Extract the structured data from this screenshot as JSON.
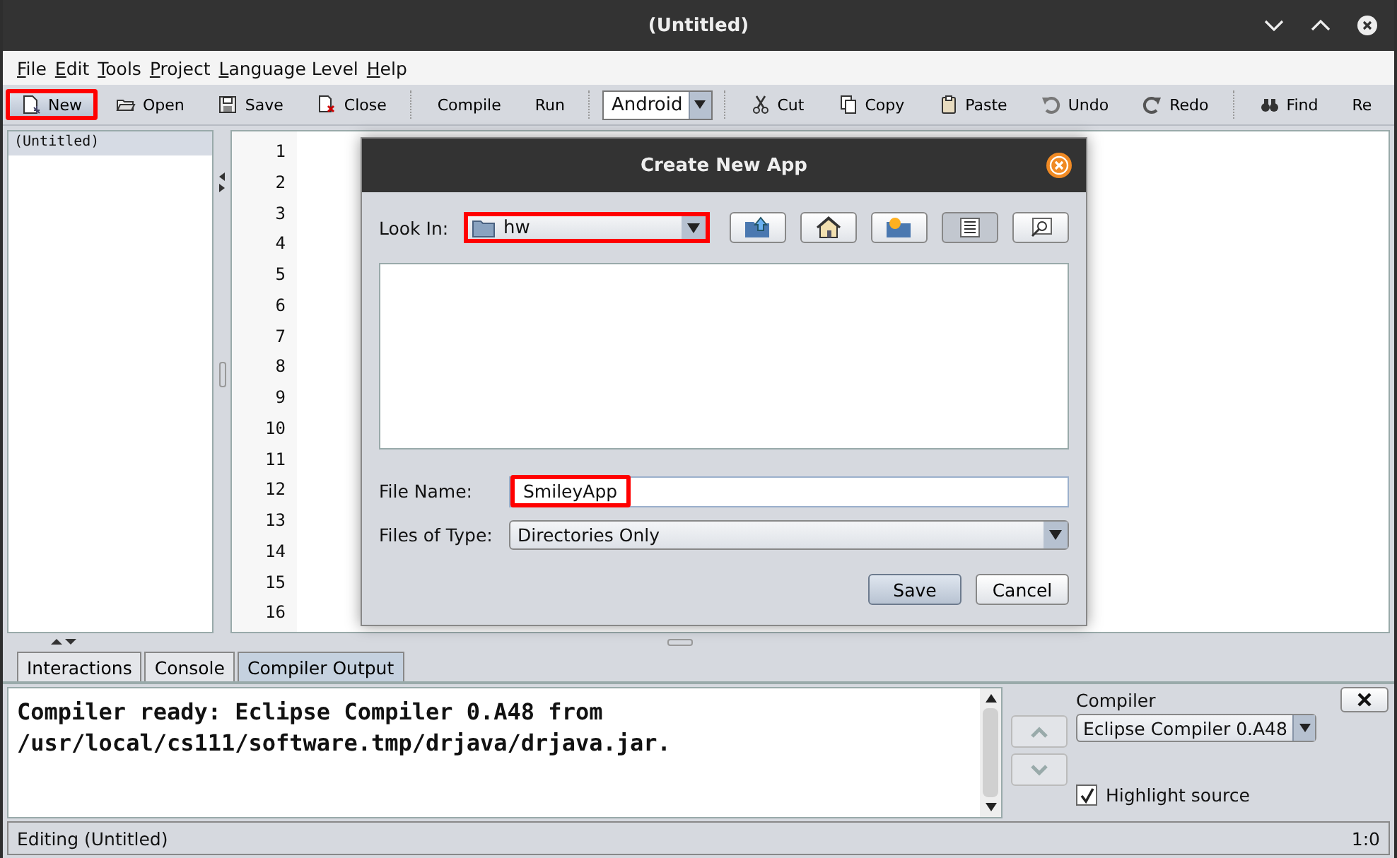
{
  "window": {
    "title": "(Untitled)"
  },
  "menu": [
    {
      "label": "File"
    },
    {
      "label": "Edit"
    },
    {
      "label": "Tools"
    },
    {
      "label": "Project"
    },
    {
      "label": "Language Level"
    },
    {
      "label": "Help"
    }
  ],
  "toolbar": [
    [
      {
        "kind": "button",
        "label": "New",
        "highlighted": true
      },
      {
        "kind": "button",
        "label": "Open",
        "highlighted": false
      },
      {
        "kind": "button",
        "label": "Save",
        "highlighted": false
      },
      {
        "kind": "button",
        "label": "Close",
        "highlighted": false
      }
    ],
    [
      {
        "kind": "text",
        "label": "Compile",
        "highlighted": false
      },
      {
        "kind": "text",
        "label": "Run",
        "highlighted": false
      }
    ],
    [
      {
        "kind": "combo",
        "label": "Android",
        "highlighted": false
      }
    ],
    [
      {
        "kind": "button",
        "label": "Cut",
        "highlighted": false
      },
      {
        "kind": "button",
        "label": "Copy",
        "highlighted": false
      },
      {
        "kind": "button",
        "label": "Paste",
        "highlighted": false
      },
      {
        "kind": "button",
        "label": "Undo",
        "highlighted": false
      },
      {
        "kind": "button",
        "label": "Redo",
        "highlighted": false
      }
    ],
    [
      {
        "kind": "button",
        "label": "Find",
        "highlighted": false
      },
      {
        "kind": "text",
        "label": "Re",
        "highlighted": false
      }
    ]
  ],
  "documents": [
    {
      "label": "(Untitled)",
      "selected": true
    }
  ],
  "editor": {
    "line_numbers": [
      "1",
      "2",
      "3",
      "4",
      "5",
      "6",
      "7",
      "8",
      "9",
      "10",
      "11",
      "12",
      "13",
      "14",
      "15",
      "16"
    ]
  },
  "dialog": {
    "title": "Create New App",
    "look_in": {
      "label": "Look In:",
      "value": "hw",
      "highlighted": true
    },
    "file_name": {
      "label": "File Name:",
      "value": "SmileyApp",
      "highlighted": true
    },
    "files_of_type": {
      "label": "Files of Type:",
      "value": "Directories Only"
    },
    "buttons": [
      "Save",
      "Cancel"
    ]
  },
  "bottom": {
    "tabs": [
      {
        "label": "Interactions",
        "selected": false
      },
      {
        "label": "Console",
        "selected": false
      },
      {
        "label": "Compiler Output",
        "selected": true
      }
    ],
    "output": [
      "Compiler ready: Eclipse Compiler 0.A48 from",
      "/usr/local/cs111/software.tmp/drjava/drjava.jar."
    ],
    "compiler": {
      "label": "Compiler",
      "value": "Eclipse Compiler 0.A48"
    },
    "highlight_source": {
      "label": "Highlight source",
      "checked": true
    }
  },
  "status_bar": {
    "text": "Editing (Untitled)",
    "position": "1:0"
  }
}
